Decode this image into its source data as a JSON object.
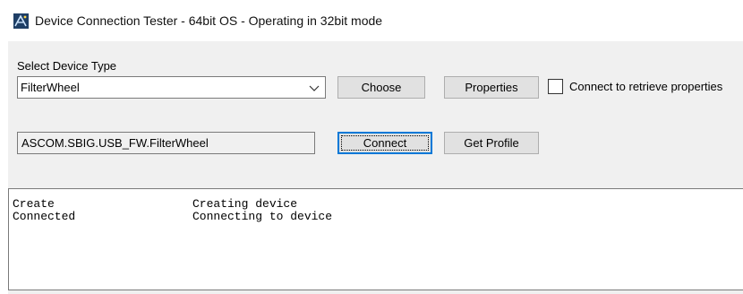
{
  "window": {
    "title": "Device Connection Tester - 64bit OS - Operating in 32bit mode",
    "icon": "ascom-app-icon"
  },
  "device_type": {
    "label": "Select Device Type",
    "selected": "FilterWheel"
  },
  "buttons": {
    "choose": "Choose",
    "properties": "Properties",
    "connect": "Connect",
    "get_profile": "Get Profile"
  },
  "connect_checkbox": {
    "label": "Connect to retrieve properties",
    "checked": false
  },
  "driver_id": {
    "value": "ASCOM.SBIG.USB_FW.FilterWheel"
  },
  "log": [
    {
      "action": "Create",
      "message": "Creating device"
    },
    {
      "action": "Connected",
      "message": "Connecting to device"
    }
  ],
  "colors": {
    "accent": "#0078d7",
    "panel": "#f0f0f0",
    "button": "#e1e1e1",
    "border": "#7a7a7a"
  }
}
